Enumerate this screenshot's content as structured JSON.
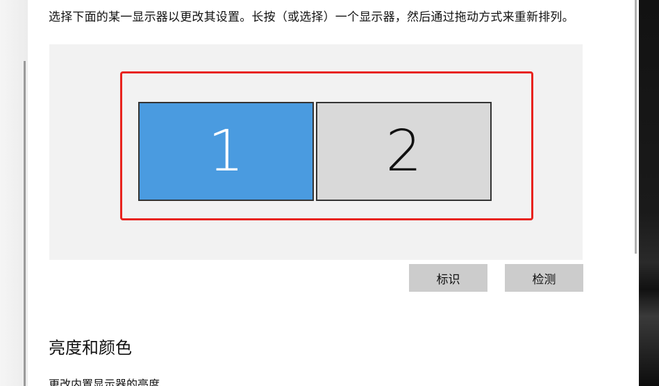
{
  "display": {
    "instruction": "选择下面的某一显示器以更改其设置。长按（或选择）一个显示器，然后通过拖动方式来重新排列。",
    "monitors": [
      {
        "label": "1",
        "selected": true
      },
      {
        "label": "2",
        "selected": false
      }
    ],
    "identify_label": "标识",
    "detect_label": "检测"
  },
  "brightness": {
    "title": "亮度和颜色",
    "sub_label": "更改内置显示器的亮度"
  },
  "colors": {
    "selected_monitor": "#4a9be0",
    "unselected_monitor": "#d9d9d9",
    "highlight": "#e8231e",
    "button_bg": "#cccccc"
  }
}
